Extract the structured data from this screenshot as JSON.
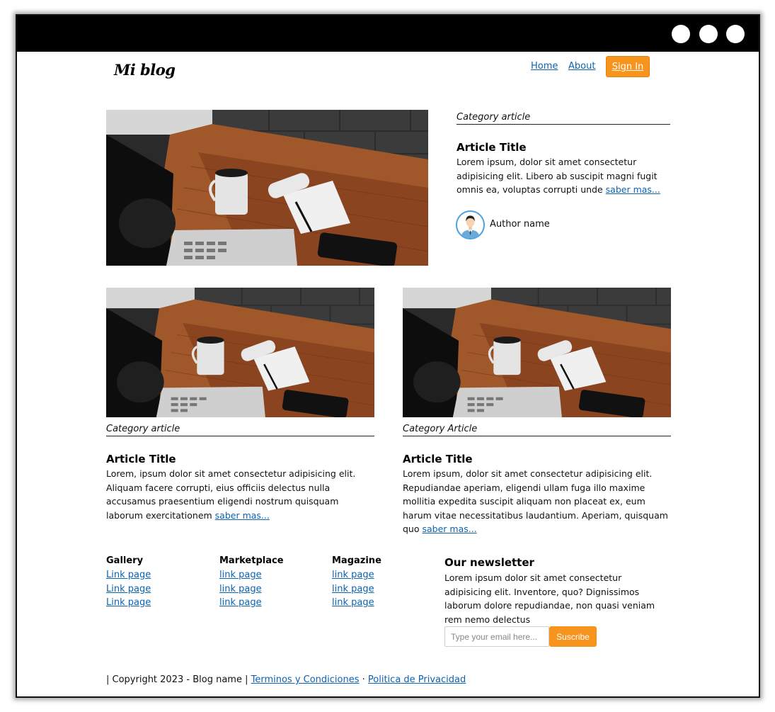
{
  "window": {
    "controls": [
      "circle",
      "circle",
      "circle"
    ]
  },
  "header": {
    "logo": "Mi blog",
    "nav": {
      "home": "Home",
      "about": "About",
      "sign_in": "Sign In"
    }
  },
  "featured": {
    "category": "Category article",
    "title": "Article Title",
    "text": "Lorem ipsum, dolor sit amet consectetur adipisicing elit. Libero ab suscipit magni fugit omnis ea, voluptas corrupti unde ",
    "more": "saber mas...",
    "author": "Author name"
  },
  "articles": [
    {
      "category": "Category article",
      "title": "Article Title",
      "text": "Lorem, ipsum dolor sit amet consectetur adipisicing elit. Aliquam facere corrupti, eius officiis delectus nulla accusamus praesentium eligendi nostrum quisquam laborum exercitationem ",
      "more": "saber mas..."
    },
    {
      "category": "Category Article",
      "title": "Article Title",
      "text": "Lorem ipsum, dolor sit amet consectetur adipisicing elit. Repudiandae aperiam, eligendi ullam fuga illo maxime mollitia expedita suscipit aliquam non placeat ex, eum harum vitae necessitatibus laudantium. Aperiam, quisquam quo ",
      "more": "saber mas..."
    }
  ],
  "footer": {
    "columns": [
      {
        "heading": "Gallery",
        "links": [
          "Link page",
          "Link page",
          "Link page"
        ]
      },
      {
        "heading": "Marketplace",
        "links": [
          "link page",
          "link page",
          "link page"
        ]
      },
      {
        "heading": "Magazine",
        "links": [
          "link page",
          "link page",
          "link page"
        ]
      }
    ],
    "newsletter": {
      "title": "Our newsletter",
      "text": "Lorem ipsum dolor sit amet consectetur adipisicing elit. Inventore, quo? Dignissimos laborum dolore repudiandae, non quasi veniam rem nemo delectus",
      "placeholder": "Type your email here...",
      "button": "Suscribe"
    },
    "copyright": "| Copyright 2023 - Blog name | ",
    "terms": "Terminos y Condiciones",
    "separator": " · ",
    "privacy": "Politica de Privacidad"
  },
  "colors": {
    "accent": "#f7941d",
    "link": "#0b63b3",
    "topbar": "#000000"
  }
}
